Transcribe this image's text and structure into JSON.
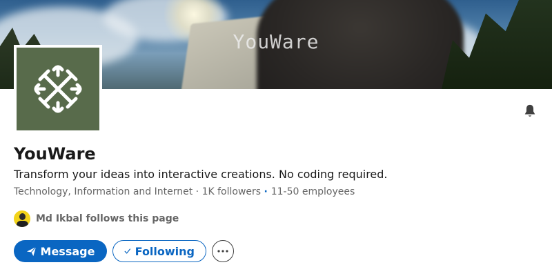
{
  "banner": {
    "title": "YouWare"
  },
  "company": {
    "name": "YouWare",
    "tagline": "Transform your ideas into interactive creations. No coding required.",
    "industry": "Technology, Information and Internet",
    "followers": "1K followers",
    "employees": "11-50 employees",
    "logo_color": "#586b4b"
  },
  "follower_highlight": {
    "text": "Md Ikbal follows this page"
  },
  "actions": {
    "message_label": "Message",
    "following_label": "Following"
  },
  "icons": {
    "bell": "bell-icon",
    "send": "send-icon",
    "check": "check-icon",
    "more": "more-icon"
  },
  "colors": {
    "brand": "#0a66c2",
    "muted": "#666666",
    "text": "#191919"
  }
}
